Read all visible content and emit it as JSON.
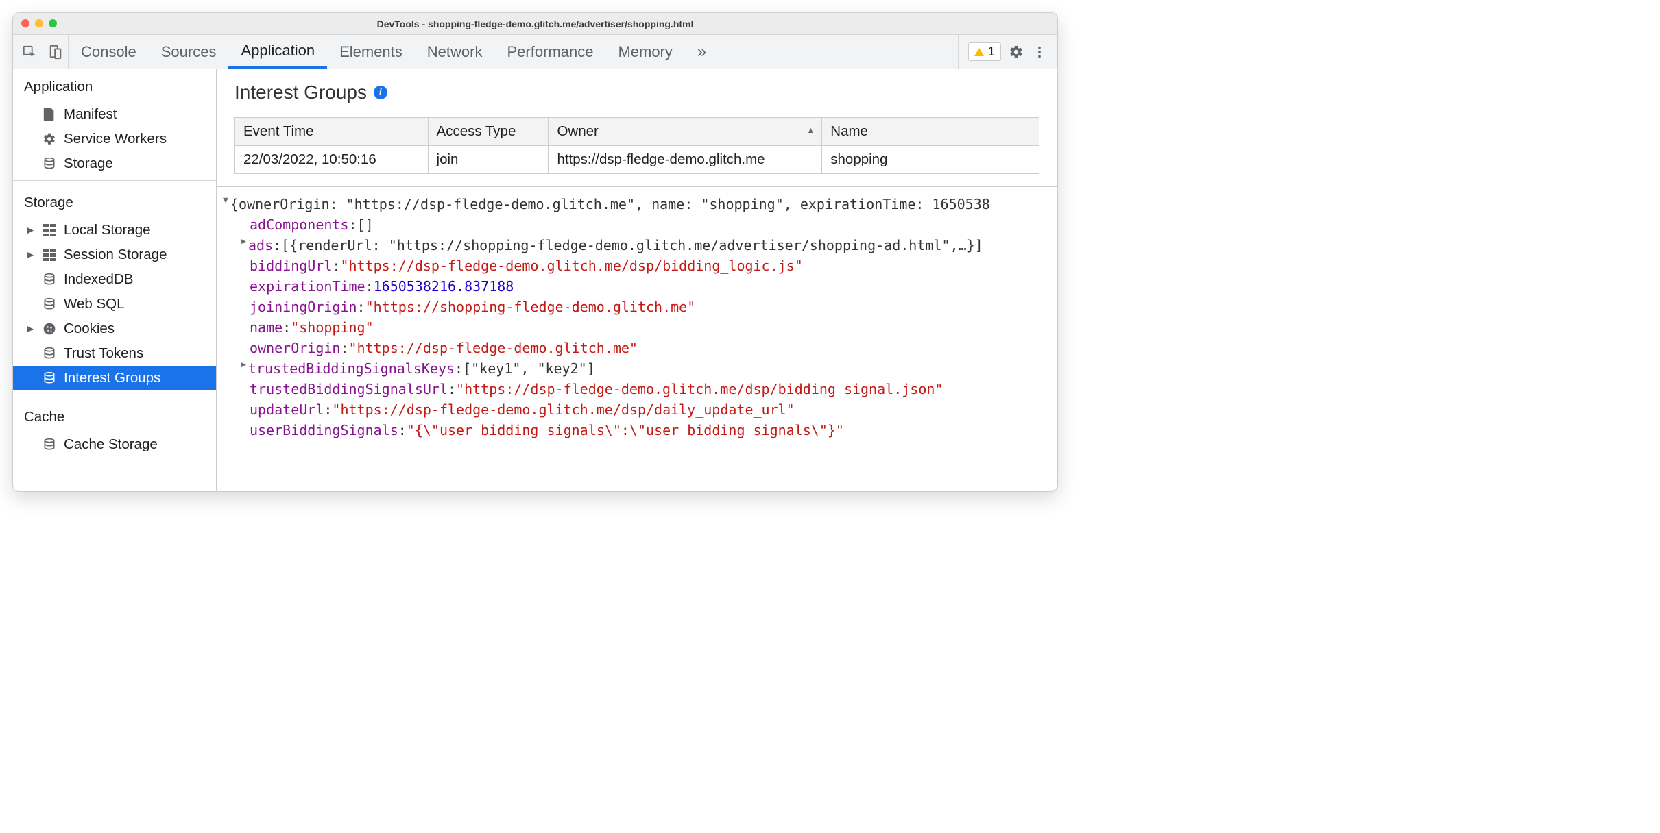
{
  "window": {
    "title_prefix": "DevTools - ",
    "title_url": "shopping-fledge-demo.glitch.me/advertiser/shopping.html"
  },
  "toolbar": {
    "tabs": [
      "Console",
      "Sources",
      "Application",
      "Elements",
      "Network",
      "Performance",
      "Memory"
    ],
    "active_tab": "Application",
    "warnings_count": "1"
  },
  "sidebar": {
    "sections": [
      {
        "title": "Application",
        "items": [
          {
            "label": "Manifest",
            "icon": "file",
            "arrow": false
          },
          {
            "label": "Service Workers",
            "icon": "gear",
            "arrow": false
          },
          {
            "label": "Storage",
            "icon": "db",
            "arrow": false
          }
        ]
      },
      {
        "title": "Storage",
        "items": [
          {
            "label": "Local Storage",
            "icon": "grid",
            "arrow": true
          },
          {
            "label": "Session Storage",
            "icon": "grid",
            "arrow": true
          },
          {
            "label": "IndexedDB",
            "icon": "db",
            "arrow": false
          },
          {
            "label": "Web SQL",
            "icon": "db",
            "arrow": false
          },
          {
            "label": "Cookies",
            "icon": "cookie",
            "arrow": true
          },
          {
            "label": "Trust Tokens",
            "icon": "db",
            "arrow": false
          },
          {
            "label": "Interest Groups",
            "icon": "db",
            "arrow": false,
            "selected": true
          }
        ]
      },
      {
        "title": "Cache",
        "items": [
          {
            "label": "Cache Storage",
            "icon": "db",
            "arrow": false
          }
        ]
      }
    ]
  },
  "heading": "Interest Groups",
  "table": {
    "headers": [
      "Event Time",
      "Access Type",
      "Owner",
      "Name"
    ],
    "sort_col": 2,
    "rows": [
      {
        "event_time": "22/03/2022, 10:50:16",
        "access_type": "join",
        "owner": "https://dsp-fledge-demo.glitch.me",
        "name": "shopping"
      }
    ]
  },
  "json_detail": {
    "summary_line": "{ownerOrigin: \"https://dsp-fledge-demo.glitch.me\", name: \"shopping\", expirationTime: 1650538",
    "props": {
      "adComponents_value": "[]",
      "ads_preview": "[{renderUrl: \"https://shopping-fledge-demo.glitch.me/advertiser/shopping-ad.html\",…}]",
      "biddingUrl": "\"https://dsp-fledge-demo.glitch.me/dsp/bidding_logic.js\"",
      "expirationTime": "1650538216.837188",
      "joiningOrigin": "\"https://shopping-fledge-demo.glitch.me\"",
      "name": "\"shopping\"",
      "ownerOrigin": "\"https://dsp-fledge-demo.glitch.me\"",
      "trustedBiddingSignalsKeys_preview": "[\"key1\", \"key2\"]",
      "trustedBiddingSignalsUrl": "\"https://dsp-fledge-demo.glitch.me/dsp/bidding_signal.json\"",
      "updateUrl": "\"https://dsp-fledge-demo.glitch.me/dsp/daily_update_url\"",
      "userBiddingSignals": "\"{\\\"user_bidding_signals\\\":\\\"user_bidding_signals\\\"}\""
    },
    "keys": {
      "adComponents": "adComponents",
      "ads": "ads",
      "biddingUrl": "biddingUrl",
      "expirationTime": "expirationTime",
      "joiningOrigin": "joiningOrigin",
      "name": "name",
      "ownerOrigin": "ownerOrigin",
      "trustedBiddingSignalsKeys": "trustedBiddingSignalsKeys",
      "trustedBiddingSignalsUrl": "trustedBiddingSignalsUrl",
      "updateUrl": "updateUrl",
      "userBiddingSignals": "userBiddingSignals"
    }
  }
}
